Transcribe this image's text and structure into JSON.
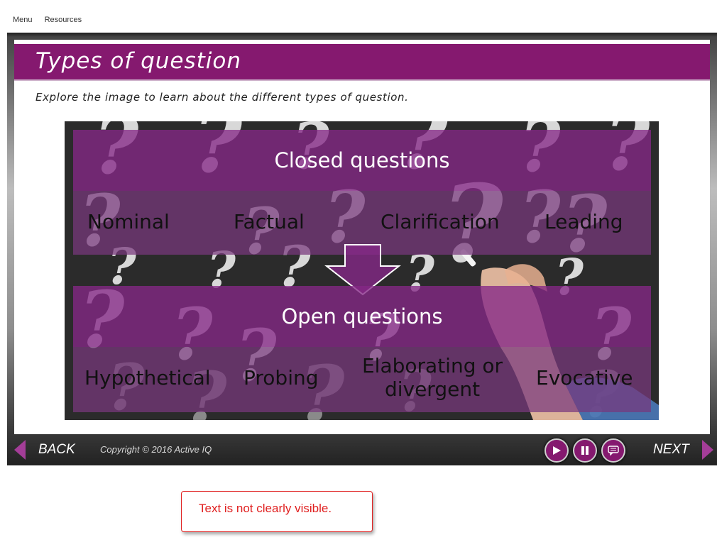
{
  "top_menu": {
    "menu": "Menu",
    "resources": "Resources"
  },
  "slide": {
    "title": "Types of question",
    "instruction": "Explore the image to learn about the different types of question."
  },
  "diagram": {
    "closed_heading": "Closed questions",
    "closed_items": [
      "Nominal",
      "Factual",
      "Clarification",
      "Leading"
    ],
    "open_heading": "Open questions",
    "open_items": [
      "Hypothetical",
      "Probing",
      "Elaborating or divergent",
      "Evocative"
    ]
  },
  "nav": {
    "back": "BACK",
    "next": "NEXT",
    "copyright": "Copyright © 2016 Active IQ"
  },
  "annotation": {
    "text": "Text is not clearly visible."
  },
  "colors": {
    "brand": "#85196f",
    "annotation": "#e02020"
  }
}
